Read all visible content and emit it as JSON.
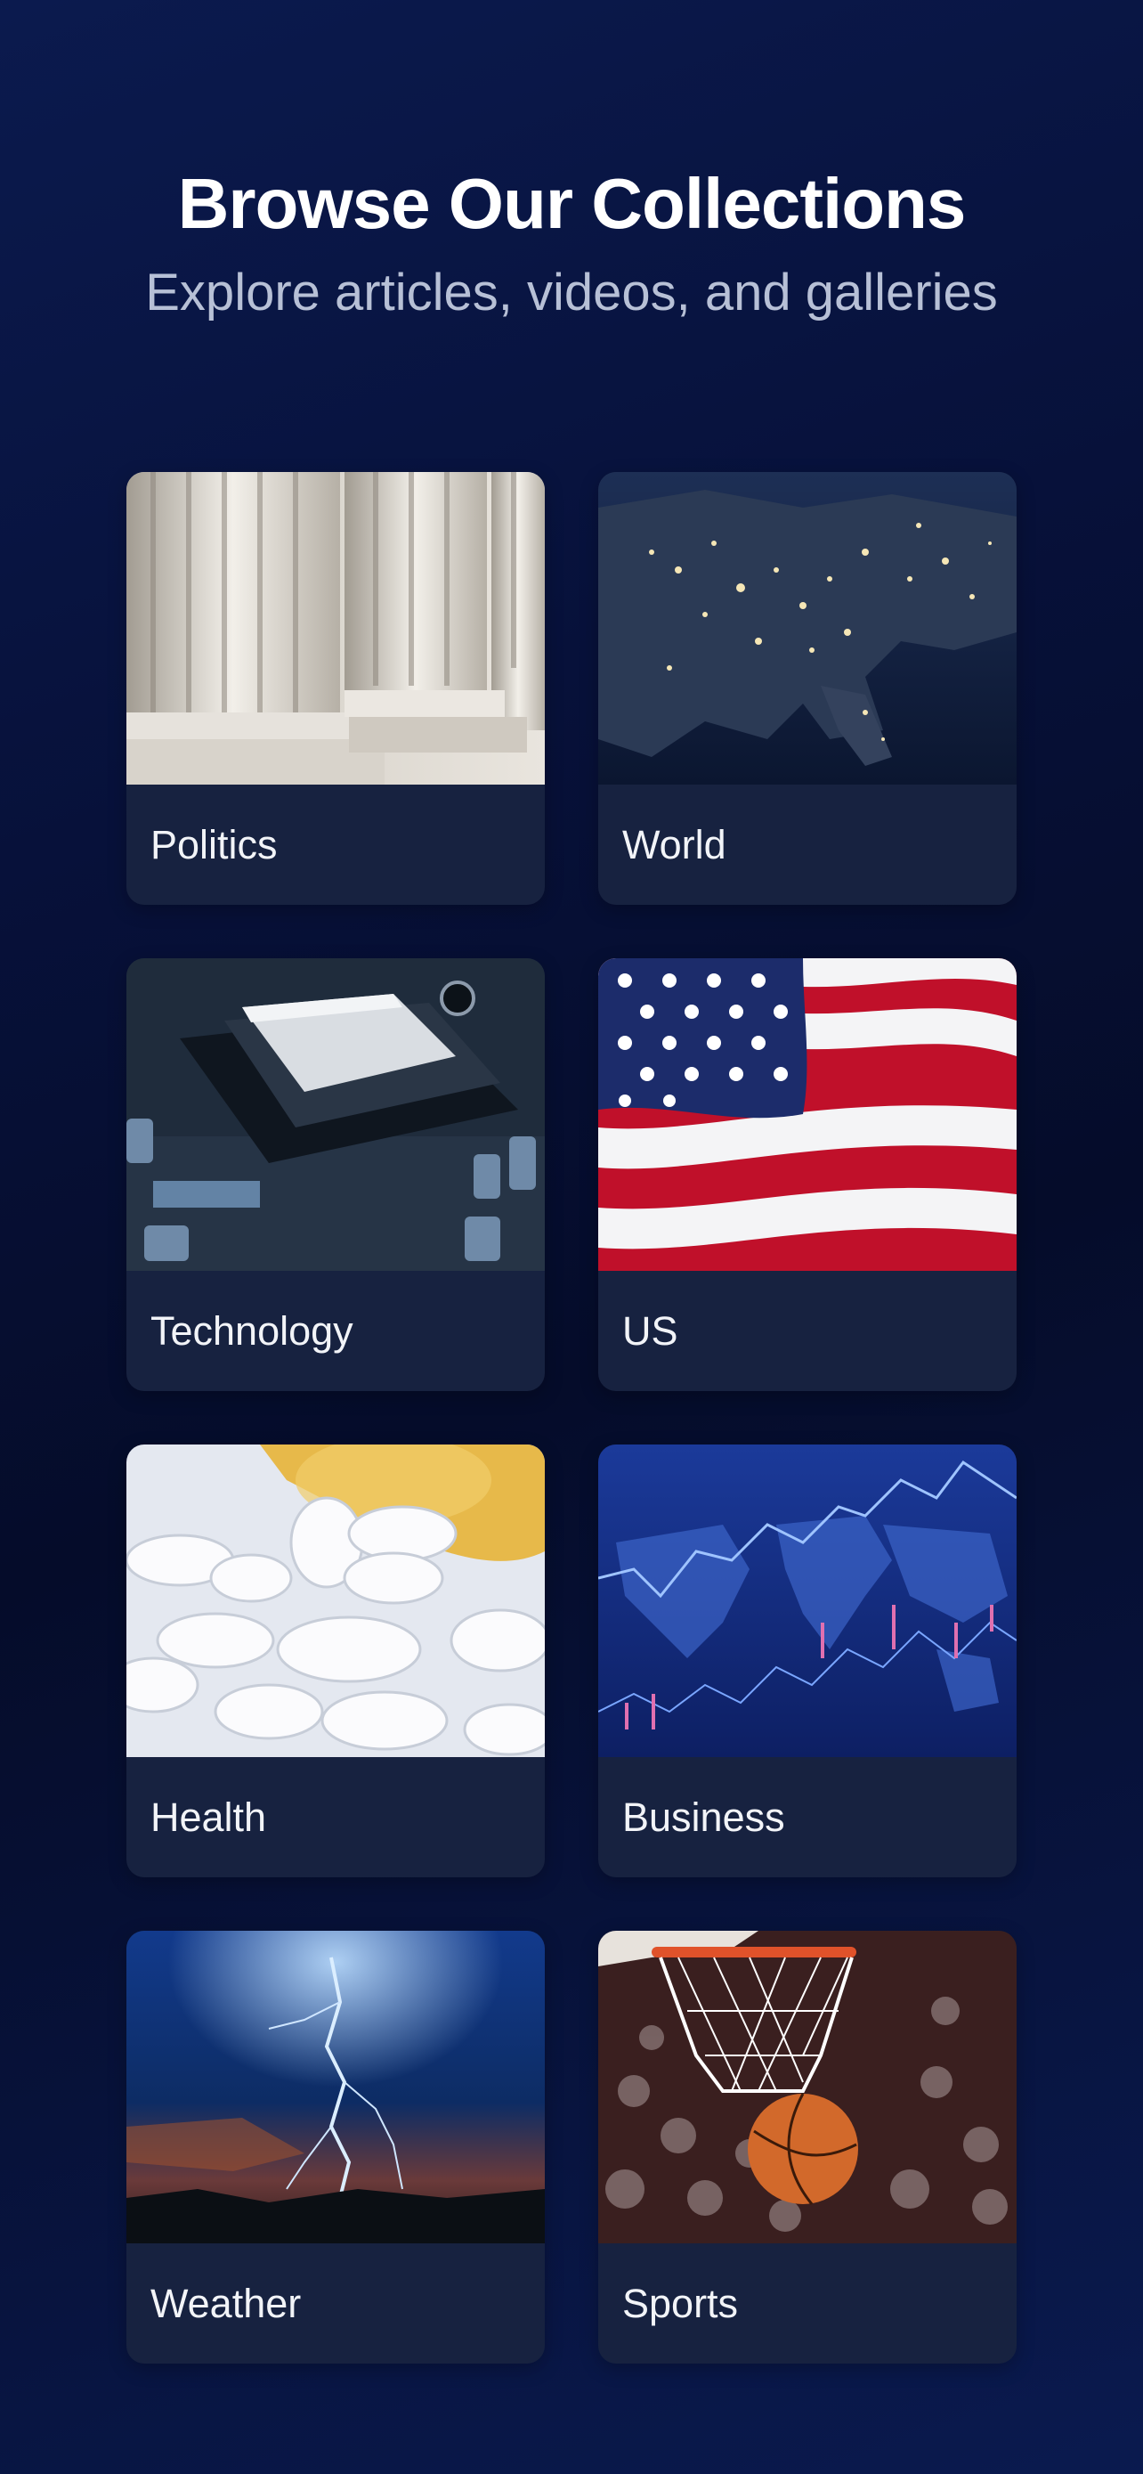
{
  "header": {
    "title": "Browse Our Collections",
    "subtitle": "Explore articles, videos, and galleries"
  },
  "collections": [
    {
      "label": "Politics",
      "image": "marble-columns-image"
    },
    {
      "label": "World",
      "image": "earth-at-night-image"
    },
    {
      "label": "Technology",
      "image": "circuit-board-cpu-image"
    },
    {
      "label": "US",
      "image": "american-flag-image"
    },
    {
      "label": "Health",
      "image": "pills-bottle-image"
    },
    {
      "label": "Business",
      "image": "stock-chart-world-map-image"
    },
    {
      "label": "Weather",
      "image": "lightning-storm-image"
    },
    {
      "label": "Sports",
      "image": "basketball-hoop-image"
    }
  ],
  "colors": {
    "background": "#07113a",
    "card": "#172240",
    "title": "#ffffff",
    "subtitle": "#b7c0d6"
  }
}
